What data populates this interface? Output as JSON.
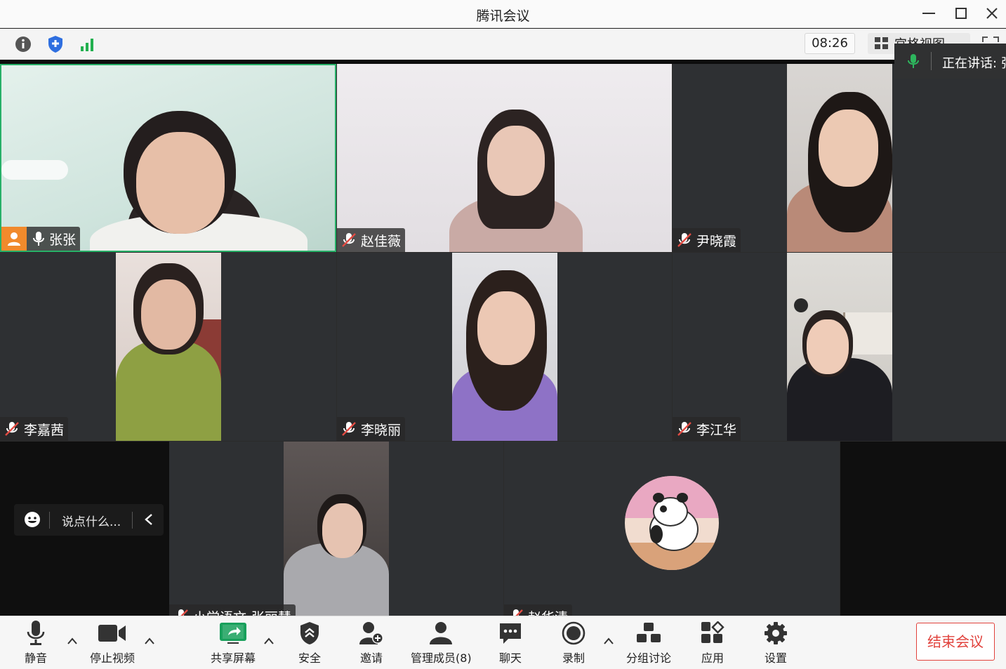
{
  "window": {
    "title": "腾讯会议"
  },
  "infobar": {
    "icons": [
      "info-icon",
      "shield-icon",
      "signal-icon"
    ],
    "time": "08:26",
    "view_label": "宫格视图"
  },
  "speaking": {
    "label": "正在讲话: 张"
  },
  "participants": [
    {
      "name": "张张",
      "mic": "on",
      "host": true
    },
    {
      "name": "赵佳薇",
      "mic": "muted"
    },
    {
      "name": "尹晓霞",
      "mic": "muted"
    },
    {
      "name": "李嘉茜",
      "mic": "muted"
    },
    {
      "name": "李晓丽",
      "mic": "muted"
    },
    {
      "name": "李江华",
      "mic": "muted"
    },
    {
      "name": "小学语文-张丽慧",
      "mic": "muted"
    },
    {
      "name": "赵华清",
      "mic": "muted"
    }
  ],
  "chat": {
    "placeholder": "说点什么..."
  },
  "toolbar": {
    "mute": "静音",
    "stop_video": "停止视频",
    "share_screen": "共享屏幕",
    "security": "安全",
    "invite": "邀请",
    "members": "管理成员(8)",
    "chat": "聊天",
    "record": "录制",
    "breakout": "分组讨论",
    "apps": "应用",
    "settings": "设置",
    "end": "结束会议"
  },
  "colors": {
    "end": "#e1423c",
    "mic_on": "#2db55d",
    "share": "#19a05c",
    "host_badge": "#f18a2c",
    "active_border": "#27b068"
  }
}
